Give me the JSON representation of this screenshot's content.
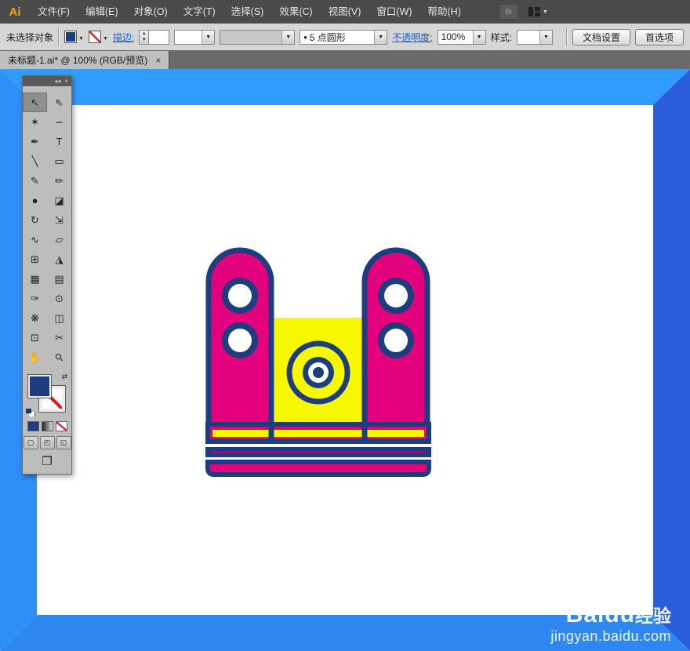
{
  "app": {
    "logo": "Ai"
  },
  "menu": {
    "items": [
      "文件(F)",
      "编辑(E)",
      "对象(O)",
      "文字(T)",
      "选择(S)",
      "效果(C)",
      "视图(V)",
      "窗口(W)",
      "帮助(H)"
    ],
    "bridge": "Br"
  },
  "ui": {
    "caret": "▼",
    "up": "▲",
    "down": "▼",
    "collapse": "◂◂",
    "close": "×",
    "swap": "⇄"
  },
  "control_bar": {
    "status": "未选择对象",
    "stroke_link": "描边:",
    "brush_bullet": "•",
    "brush_value": "5 点圆形",
    "opacity_link": "不透明度:",
    "opacity_value": "100%",
    "style_label": "样式:",
    "document_setup": "文档设置",
    "preferences": "首选项"
  },
  "tab_bar": {
    "title": "未标题-1.ai* @ 100% (RGB/预览)",
    "close": "×"
  },
  "tools": {
    "items": [
      {
        "name": "selection-tool",
        "glyph": "↖"
      },
      {
        "name": "direct-selection-tool",
        "glyph": "⇖"
      },
      {
        "name": "magic-wand-tool",
        "glyph": "✶"
      },
      {
        "name": "lasso-tool",
        "glyph": "∽"
      },
      {
        "name": "pen-tool",
        "glyph": "✒"
      },
      {
        "name": "type-tool",
        "glyph": "T"
      },
      {
        "name": "line-segment-tool",
        "glyph": "╲"
      },
      {
        "name": "rectangle-tool",
        "glyph": "▭"
      },
      {
        "name": "paintbrush-tool",
        "glyph": "✎"
      },
      {
        "name": "pencil-tool",
        "glyph": "✏"
      },
      {
        "name": "blob-brush-tool",
        "glyph": "●"
      },
      {
        "name": "eraser-tool",
        "glyph": "◪"
      },
      {
        "name": "rotate-tool",
        "glyph": "↻"
      },
      {
        "name": "scale-tool",
        "glyph": "⇲"
      },
      {
        "name": "width-tool",
        "glyph": "∿"
      },
      {
        "name": "free-transform-tool",
        "glyph": "▱"
      },
      {
        "name": "shape-builder-tool",
        "glyph": "⊞"
      },
      {
        "name": "perspective-grid-tool",
        "glyph": "◮"
      },
      {
        "name": "mesh-tool",
        "glyph": "▦"
      },
      {
        "name": "gradient-tool",
        "glyph": "▤"
      },
      {
        "name": "eyedropper-tool",
        "glyph": "✑"
      },
      {
        "name": "blend-tool",
        "glyph": "⊙"
      },
      {
        "name": "symbol-sprayer-tool",
        "glyph": "❋"
      },
      {
        "name": "column-graph-tool",
        "glyph": "◫"
      },
      {
        "name": "artboard-tool",
        "glyph": "⊡"
      },
      {
        "name": "slice-tool",
        "glyph": "✂"
      },
      {
        "name": "hand-tool",
        "glyph": "✋"
      },
      {
        "name": "zoom-tool",
        "glyph": "⚲"
      }
    ],
    "mode_glyphs": [
      "▢",
      "◰",
      "◱"
    ],
    "screen_mode_glyph": "❐"
  },
  "watermark": {
    "brand": "Baidu",
    "suffix": "经验",
    "url": "jingyan.baidu.com"
  },
  "colors": {
    "magenta": "#E4017E",
    "yellow": "#F7F701",
    "navy": "#1C3E7E",
    "frame-top": "#319CFF",
    "frame-left": "#2E8FF7",
    "frame-right": "#2A5EDD",
    "frame-bottom": "#2F87F0",
    "link": "#1A5FCE",
    "menu-bg": "#4A4A4A",
    "bar-bg": "#D6D6D6",
    "panel-bg": "#BDBDBD",
    "logo": "#F7A01B"
  }
}
